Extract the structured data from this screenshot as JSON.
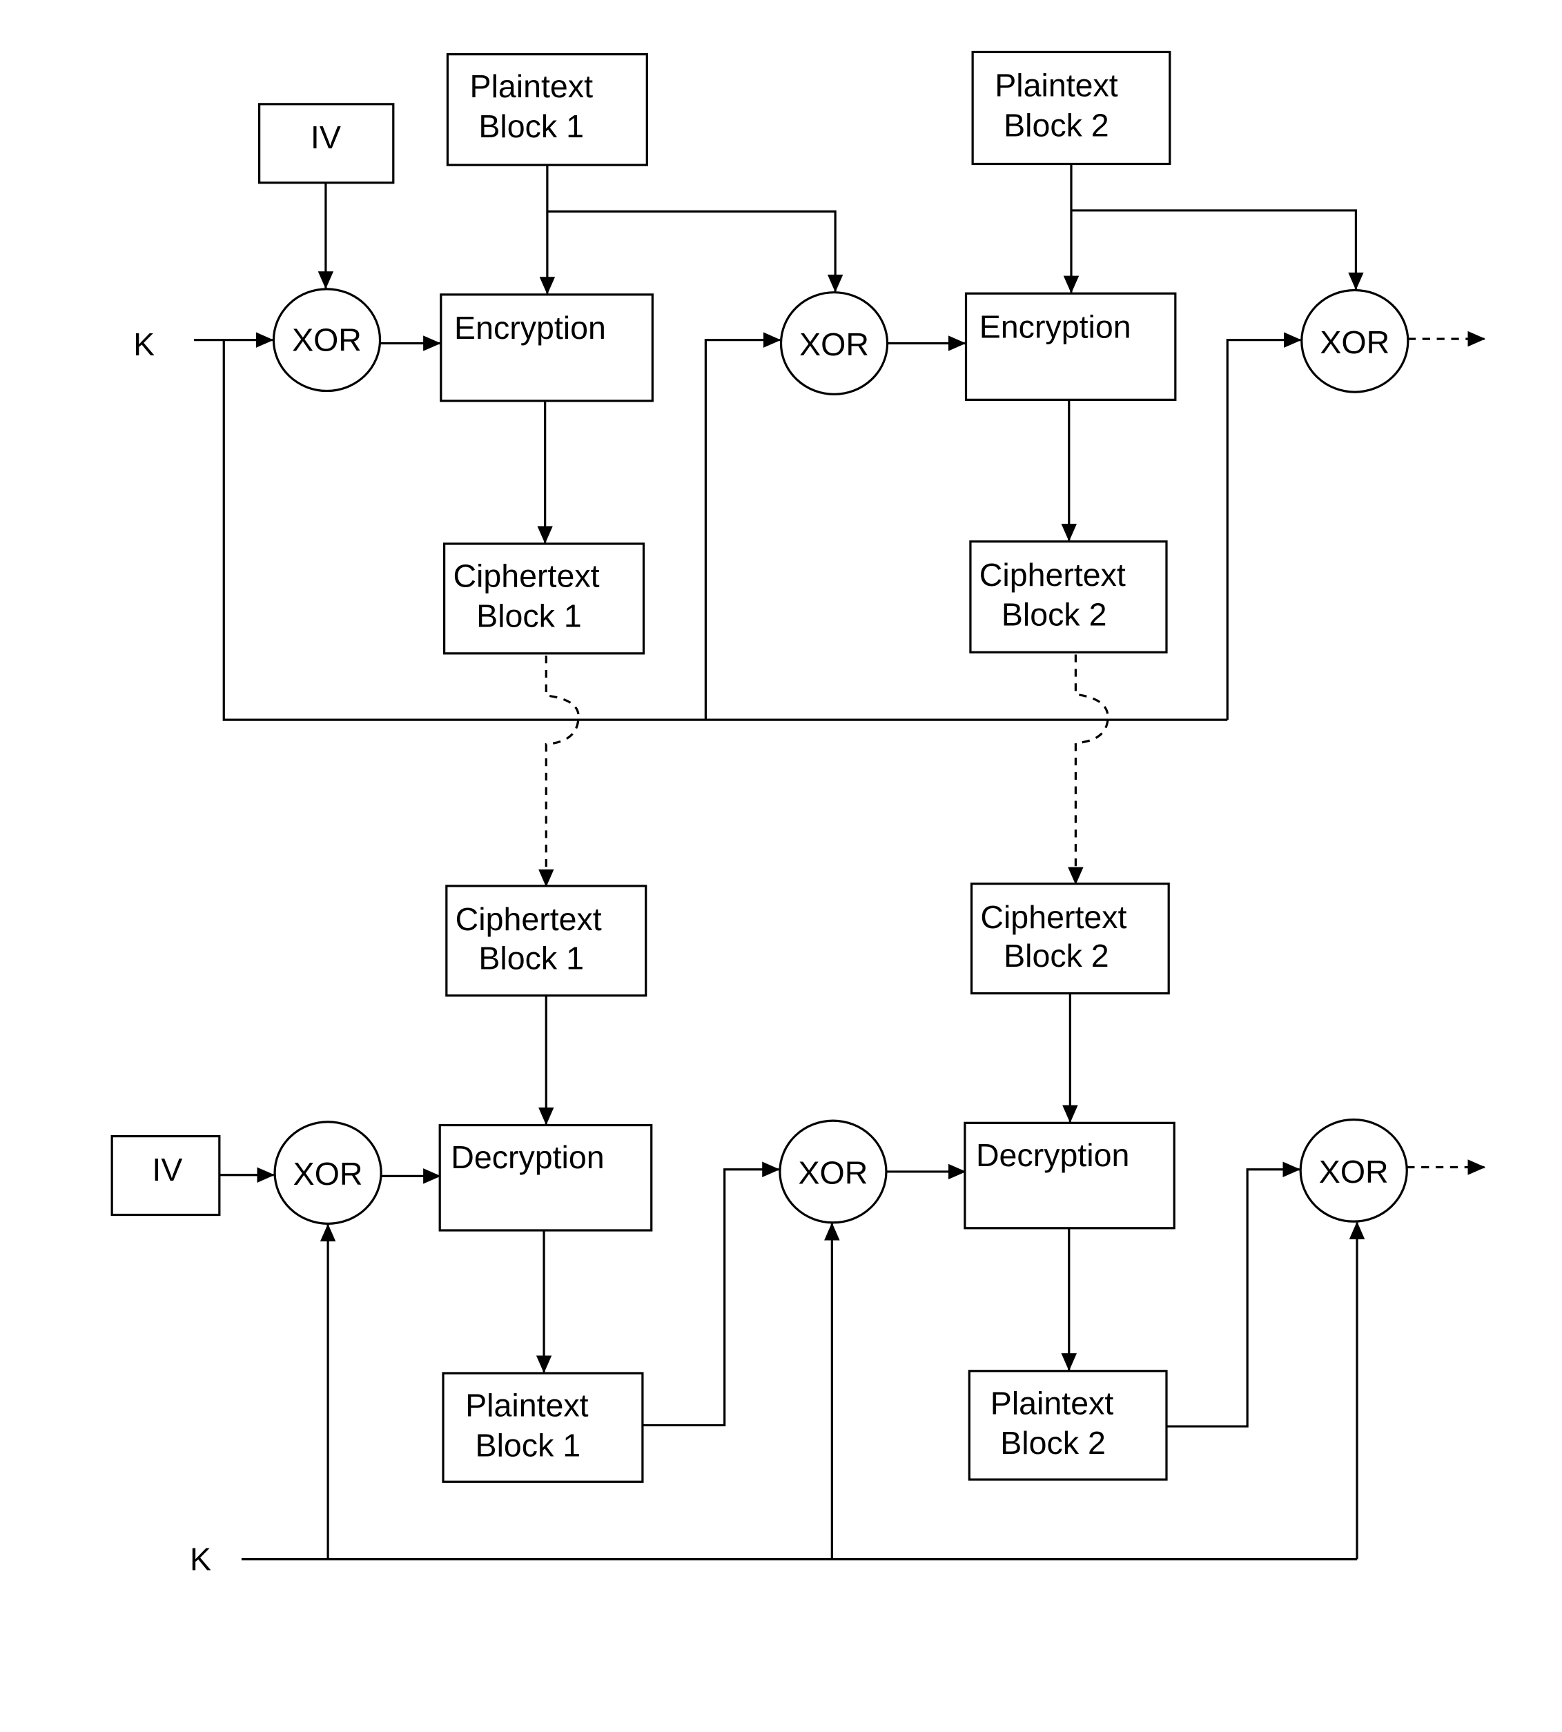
{
  "diagram": {
    "title": "",
    "colors": {
      "stroke": "#000000",
      "background": "#ffffff"
    },
    "encryption": {
      "key_label": "K",
      "iv_label": "IV",
      "plaintext_blocks": [
        {
          "line1": "Plaintext",
          "line2": "Block 1"
        },
        {
          "line1": "Plaintext",
          "line2": "Block 2"
        }
      ],
      "operation_label": "Encryption",
      "ciphertext_blocks": [
        {
          "line1": "Ciphertext",
          "line2": "Block 1"
        },
        {
          "line1": "Ciphertext",
          "line2": "Block 2"
        }
      ],
      "xor_label": "XOR"
    },
    "decryption": {
      "key_label": "K",
      "iv_label": "IV",
      "ciphertext_blocks": [
        {
          "line1": "Ciphertext",
          "line2": "Block 1"
        },
        {
          "line1": "Ciphertext",
          "line2": "Block 2"
        }
      ],
      "operation_label": "Decryption",
      "plaintext_blocks": [
        {
          "line1": "Plaintext",
          "line2": "Block 1"
        },
        {
          "line1": "Plaintext",
          "line2": "Block 2"
        }
      ],
      "xor_label": "XOR"
    }
  }
}
